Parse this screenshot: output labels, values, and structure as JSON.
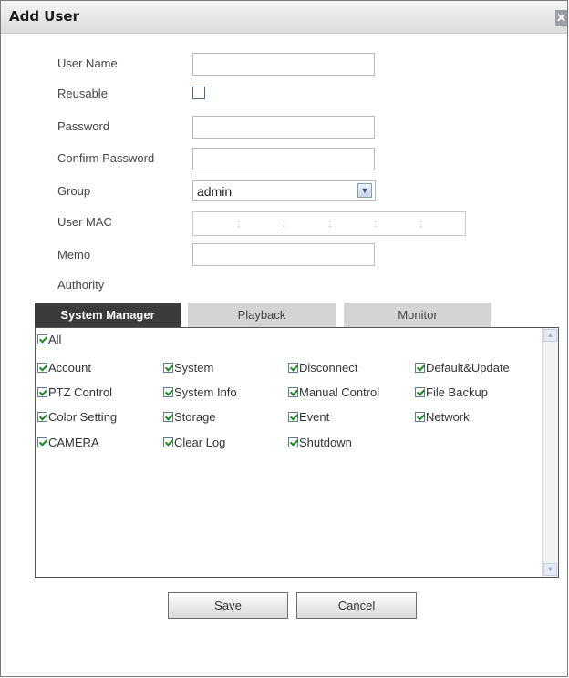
{
  "dialog": {
    "title": "Add User",
    "close_glyph": "✕"
  },
  "form": {
    "user_name_label": "User Name",
    "reusable_label": "Reusable",
    "password_label": "Password",
    "confirm_password_label": "Confirm Password",
    "group_label": "Group",
    "group_value": "admin",
    "user_mac_label": "User MAC",
    "mac_separators": [
      ":",
      ":",
      ":",
      ":",
      ":"
    ],
    "memo_label": "Memo",
    "authority_label": "Authority"
  },
  "tabs": [
    {
      "label": "System Manager",
      "active": true
    },
    {
      "label": "Playback",
      "active": false
    },
    {
      "label": "Monitor",
      "active": false
    }
  ],
  "permissions": {
    "all_label": "All",
    "items": [
      "Account",
      "System",
      "Disconnect",
      "Default&Update",
      "PTZ Control",
      "System Info",
      "Manual Control",
      "File Backup",
      "Color Setting",
      "Storage",
      "Event",
      "Network",
      "CAMERA",
      "Clear Log",
      "Shutdown"
    ],
    "all_checked": true
  },
  "buttons": {
    "save": "Save",
    "cancel": "Cancel"
  },
  "colors": {
    "active_tab": "#3b3b3b",
    "inactive_tab": "#d4d4d4",
    "check": "#1e8a1e"
  }
}
